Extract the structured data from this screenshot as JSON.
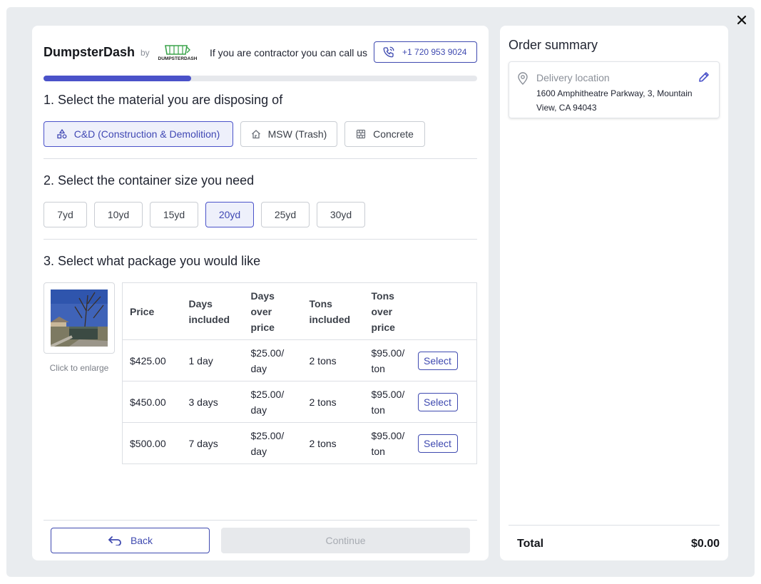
{
  "header": {
    "brand": "DumpsterDash",
    "by": "by",
    "logo_text": "DUMPSTERDASH",
    "contractor_text": "If you are contractor you can call us",
    "phone": "+1 720 953 9024"
  },
  "progress": {
    "fraction": 0.34
  },
  "step1": {
    "title": "1. Select the material you are disposing of",
    "options": [
      {
        "label": "C&D (Construction & Demolition)",
        "icon": "shapes-icon",
        "selected": true
      },
      {
        "label": "MSW (Trash)",
        "icon": "home-recycle-icon",
        "selected": false
      },
      {
        "label": "Concrete",
        "icon": "brick-icon",
        "selected": false
      }
    ]
  },
  "step2": {
    "title": "2. Select the container size you need",
    "sizes": [
      "7yd",
      "10yd",
      "15yd",
      "20yd",
      "25yd",
      "30yd"
    ],
    "selected": "20yd"
  },
  "step3": {
    "title": "3. Select what package you would like",
    "enlarge_text": "Click to enlarge",
    "columns": [
      "Price",
      "Days included",
      "Days over price",
      "Tons included",
      "Tons over price"
    ],
    "select_label": "Select",
    "rows": [
      {
        "price": "$425.00",
        "days": "1 day",
        "days_over": "$25.00/ day",
        "tons": "2 tons",
        "tons_over": "$95.00/ ton"
      },
      {
        "price": "$450.00",
        "days": "3 days",
        "days_over": "$25.00/ day",
        "tons": "2 tons",
        "tons_over": "$95.00/ ton"
      },
      {
        "price": "$500.00",
        "days": "7 days",
        "days_over": "$25.00/ day",
        "tons": "2 tons",
        "tons_over": "$95.00/ ton"
      }
    ]
  },
  "footer": {
    "back_label": "Back",
    "continue_label": "Continue"
  },
  "summary": {
    "title": "Order summary",
    "location_label": "Delivery location",
    "address": "1600 Amphitheatre Parkway, 3, Mountain View, CA 94043",
    "total_label": "Total",
    "total_value": "$0.00"
  },
  "colors": {
    "accent": "#4a52c9",
    "brand_green": "#3aa34a"
  }
}
